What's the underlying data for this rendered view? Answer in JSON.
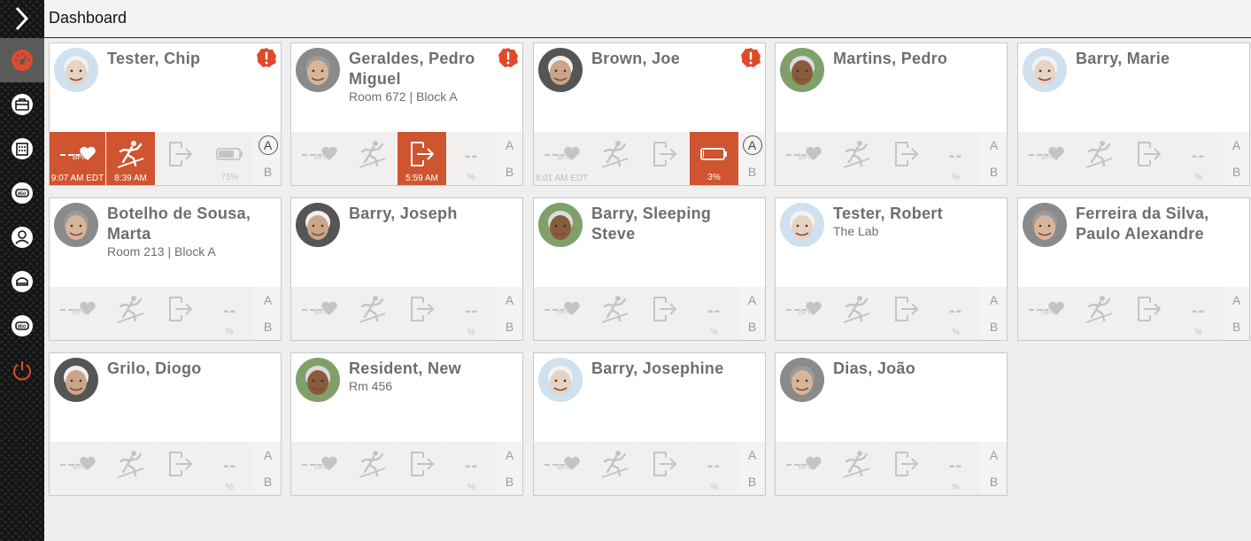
{
  "header": {
    "title": "Dashboard"
  },
  "sidebar": {
    "items": [
      {
        "name": "dashboard",
        "active": true
      },
      {
        "name": "residents"
      },
      {
        "name": "building"
      },
      {
        "name": "devices"
      },
      {
        "name": "users"
      },
      {
        "name": "settings"
      },
      {
        "name": "device-config"
      },
      {
        "name": "logout"
      }
    ]
  },
  "colors": {
    "alarm": "#cf5430",
    "sidebar": "#141414",
    "active": "#5a5a5a",
    "accent": "#e04a2a"
  },
  "labels": {
    "bpm": "BPM",
    "dash": "--",
    "percent": "%",
    "a": "A",
    "b": "B"
  },
  "cards": [
    {
      "name": "Tester, Chip",
      "room": "",
      "alert": true,
      "hr": {
        "alarm": true,
        "time": "9:07 AM EDT"
      },
      "fall": {
        "alarm": true,
        "time": "8:39 AM"
      },
      "exit": {
        "alarm": false,
        "time": ""
      },
      "battery": {
        "alarm": false,
        "level": "75%",
        "icon": true
      },
      "a_circled": true
    },
    {
      "name": "Geraldes, Pedro Miguel",
      "room": "Room 672 | Block A",
      "alert": true,
      "hr": {
        "alarm": false,
        "time": ""
      },
      "fall": {
        "alarm": false,
        "time": ""
      },
      "exit": {
        "alarm": true,
        "time": "5:59 AM"
      },
      "battery": {
        "alarm": false,
        "level": "",
        "icon": false
      },
      "a_circled": false
    },
    {
      "name": "Brown, Joe",
      "room": "",
      "alert": true,
      "hr": {
        "alarm": false,
        "time": "8:01 AM EDT"
      },
      "fall": {
        "alarm": false,
        "time": ""
      },
      "exit": {
        "alarm": false,
        "time": ""
      },
      "battery": {
        "alarm": true,
        "level": "3%",
        "icon": true
      },
      "a_circled": true
    },
    {
      "name": "Martins, Pedro",
      "room": "",
      "alert": false,
      "hr": {
        "alarm": false,
        "time": ""
      },
      "fall": {
        "alarm": false,
        "time": ""
      },
      "exit": {
        "alarm": false,
        "time": ""
      },
      "battery": {
        "alarm": false,
        "level": "",
        "icon": false
      },
      "a_circled": false
    },
    {
      "name": "Barry, Marie",
      "room": "",
      "alert": false,
      "hr": {
        "alarm": false,
        "time": ""
      },
      "fall": {
        "alarm": false,
        "time": ""
      },
      "exit": {
        "alarm": false,
        "time": ""
      },
      "battery": {
        "alarm": false,
        "level": "",
        "icon": false
      },
      "a_circled": false
    },
    {
      "name": "Botelho de Sousa, Marta",
      "room": "Room 213 | Block A",
      "alert": false,
      "hr": {
        "alarm": false,
        "time": ""
      },
      "fall": {
        "alarm": false,
        "time": ""
      },
      "exit": {
        "alarm": false,
        "time": ""
      },
      "battery": {
        "alarm": false,
        "level": "",
        "icon": false
      },
      "a_circled": false
    },
    {
      "name": "Barry, Joseph",
      "room": "",
      "alert": false,
      "hr": {
        "alarm": false,
        "time": ""
      },
      "fall": {
        "alarm": false,
        "time": ""
      },
      "exit": {
        "alarm": false,
        "time": ""
      },
      "battery": {
        "alarm": false,
        "level": "",
        "icon": false
      },
      "a_circled": false
    },
    {
      "name": "Barry, Sleeping Steve",
      "room": "",
      "alert": false,
      "hr": {
        "alarm": false,
        "time": ""
      },
      "fall": {
        "alarm": false,
        "time": ""
      },
      "exit": {
        "alarm": false,
        "time": ""
      },
      "battery": {
        "alarm": false,
        "level": "",
        "icon": false
      },
      "a_circled": false
    },
    {
      "name": "Tester, Robert",
      "room": "The Lab",
      "alert": false,
      "hr": {
        "alarm": false,
        "time": ""
      },
      "fall": {
        "alarm": false,
        "time": ""
      },
      "exit": {
        "alarm": false,
        "time": ""
      },
      "battery": {
        "alarm": false,
        "level": "",
        "icon": false
      },
      "a_circled": false
    },
    {
      "name": "Ferreira da Silva, Paulo Alexandre",
      "room": "",
      "alert": false,
      "hr": {
        "alarm": false,
        "time": ""
      },
      "fall": {
        "alarm": false,
        "time": ""
      },
      "exit": {
        "alarm": false,
        "time": ""
      },
      "battery": {
        "alarm": false,
        "level": "",
        "icon": false
      },
      "a_circled": false
    },
    {
      "name": "Grilo, Diogo",
      "room": "",
      "alert": false,
      "hr": {
        "alarm": false,
        "time": ""
      },
      "fall": {
        "alarm": false,
        "time": ""
      },
      "exit": {
        "alarm": false,
        "time": ""
      },
      "battery": {
        "alarm": false,
        "level": "",
        "icon": false
      },
      "a_circled": false
    },
    {
      "name": "Resident, New",
      "room": "Rm 456",
      "alert": false,
      "hr": {
        "alarm": false,
        "time": ""
      },
      "fall": {
        "alarm": false,
        "time": ""
      },
      "exit": {
        "alarm": false,
        "time": ""
      },
      "battery": {
        "alarm": false,
        "level": "",
        "icon": false
      },
      "a_circled": false
    },
    {
      "name": "Barry, Josephine",
      "room": "",
      "alert": false,
      "hr": {
        "alarm": false,
        "time": ""
      },
      "fall": {
        "alarm": false,
        "time": ""
      },
      "exit": {
        "alarm": false,
        "time": ""
      },
      "battery": {
        "alarm": false,
        "level": "",
        "icon": false
      },
      "a_circled": false
    },
    {
      "name": "Dias, João",
      "room": "",
      "alert": false,
      "hr": {
        "alarm": false,
        "time": ""
      },
      "fall": {
        "alarm": false,
        "time": ""
      },
      "exit": {
        "alarm": false,
        "time": ""
      },
      "battery": {
        "alarm": false,
        "level": "",
        "icon": false
      },
      "a_circled": false
    }
  ]
}
